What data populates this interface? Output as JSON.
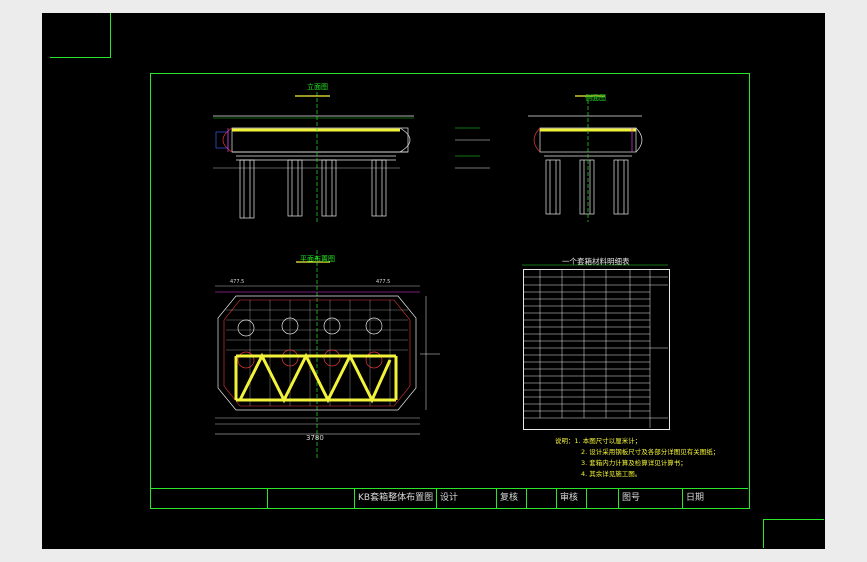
{
  "drawing": {
    "title": "KB套箱整体布置图",
    "views": {
      "top_left": "立面图",
      "top_right": "侧面图",
      "plan": "平面布置图",
      "table_title": "一个套箱材料明细表"
    },
    "title_block": {
      "design": "设计",
      "review": "复核",
      "check": "审核",
      "drawing_no": "图号",
      "date": "日期"
    },
    "dimensions": {
      "plan_width": "3780",
      "plan_top_left": "477.5",
      "plan_top_right": "477.5"
    },
    "notes": [
      "说明：1. 本图尺寸以厘米计；",
      "2. 设计采用钢板尺寸及各部分详图见有关图纸；",
      "3. 套箱内力计算及检算详见计算书；",
      "4. 其余详见施工图。"
    ],
    "colors": {
      "background": "#000000",
      "frame": "#29e629",
      "structure": "#e8e8e8",
      "highlight": "#f2f23a",
      "accent": "#e83ae8",
      "red": "#e83a3a",
      "blue": "#3a5ae8",
      "cyan": "#3ae8e8"
    }
  }
}
